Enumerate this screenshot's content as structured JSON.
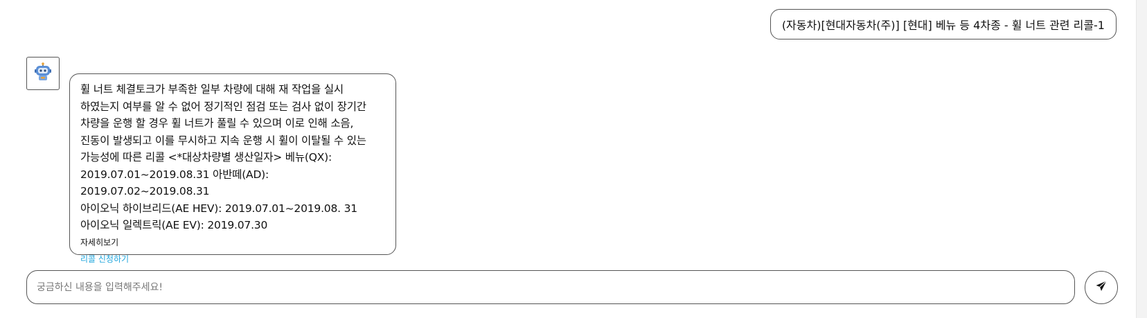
{
  "conversation": {
    "user_message": "(자동차)[현대자동차(주)] [현대] 베뉴 등 4차종 - 휠 너트 관련 리콜-1",
    "bot": {
      "avatar_icon": "robot-icon",
      "message": "휠 너트 체결토크가 부족한 일부 차량에 대해 재 작업을 실시\n하였는지 여부를 알 수 없어 정기적인 점검 또는 검사 없이 장기간\n차량을 운행 할 경우 휠 너트가 풀릴 수 있으며 이로 인해 소음,\n진동이 발생되고 이를 무시하고 지속 운행 시 휠이 이탈될 수 있는\n가능성에 따른 리콜 <*대상차량별 생산일자> 베뉴(QX):\n2019.07.01~2019.08.31 아반떼(AD): 2019.07.02~2019.08.31\n아이오닉 하이브리드(AE HEV): 2019.07.01~2019.08. 31\n아이오닉 일렉트릭(AE EV): 2019.07.30",
      "detail_link": "자세히보기",
      "recall_link": "리콜 신청하기"
    }
  },
  "composer": {
    "placeholder": "궁금하신 내용을 입력해주세요!",
    "value": "",
    "send_icon": "send-icon"
  },
  "colors": {
    "link_accent": "#1fa5dc",
    "border": "#555555",
    "robot_body": "#5b8fd6"
  }
}
